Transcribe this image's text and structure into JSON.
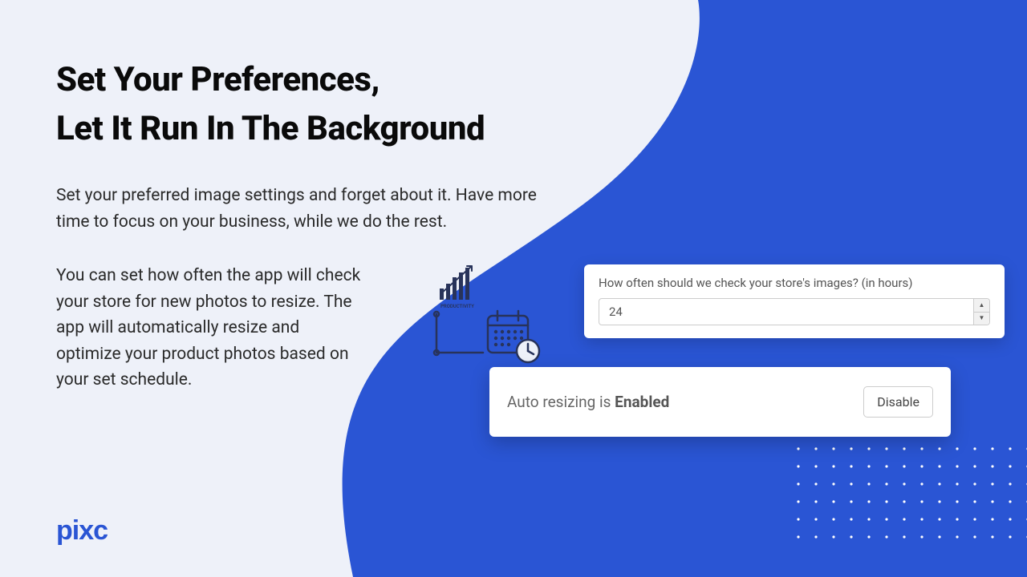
{
  "heading": {
    "line1": "Set Your Preferences,",
    "line2": "Let It Run In The Background"
  },
  "paragraph1": "Set your preferred image settings and forget about it. Have more time to focus on your business, while we do the rest.",
  "paragraph2": "You can set how often the app will check your store for new photos to resize. The app will automatically resize and optimize your product photos based on your set schedule.",
  "logo": "pixc",
  "doodle_label": "PRODUCTIVITY",
  "check_card": {
    "label": "How often should we check your store's images? (in hours)",
    "value": "24"
  },
  "status_card": {
    "prefix": "Auto resizing is ",
    "state": "Enabled",
    "button": "Disable"
  },
  "colors": {
    "blue": "#2a55d4",
    "bg": "#eef1f9"
  }
}
